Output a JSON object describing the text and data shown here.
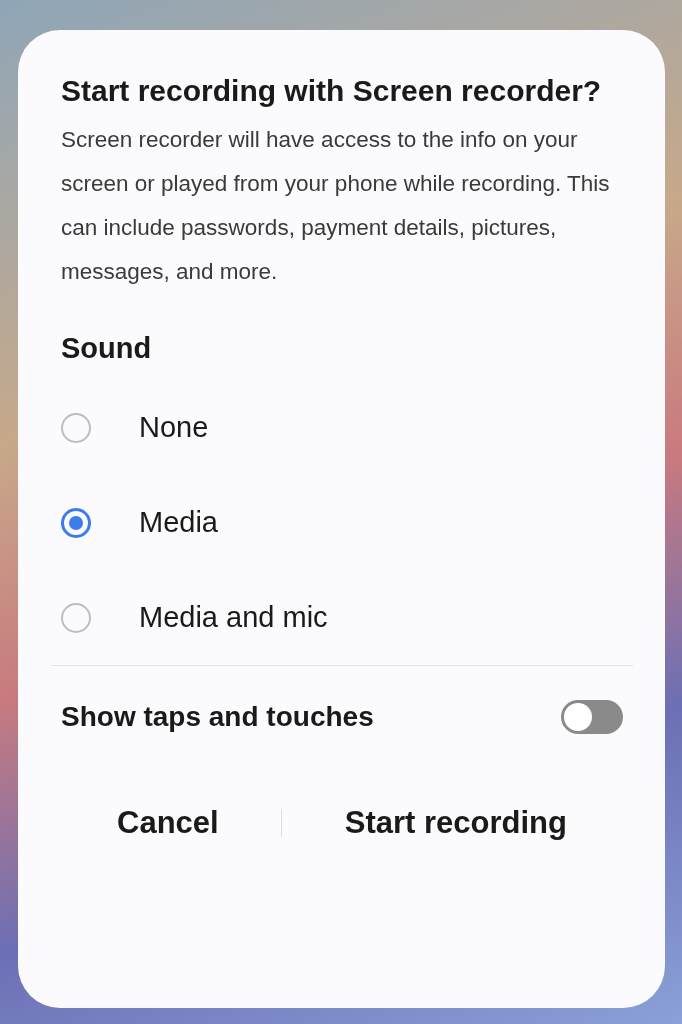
{
  "dialog": {
    "title": "Start recording with Screen recorder?",
    "message": "Screen recorder will have access to the info on your screen or played from your phone while recording. This can include passwords, payment details, pictures, messages, and more.",
    "sound": {
      "heading": "Sound",
      "options": [
        {
          "label": "None",
          "selected": false
        },
        {
          "label": "Media",
          "selected": true
        },
        {
          "label": "Media and mic",
          "selected": false
        }
      ]
    },
    "show_taps": {
      "label": "Show taps and touches",
      "on": false
    },
    "buttons": [
      {
        "label": "Cancel"
      },
      {
        "label": "Start recording"
      }
    ]
  }
}
